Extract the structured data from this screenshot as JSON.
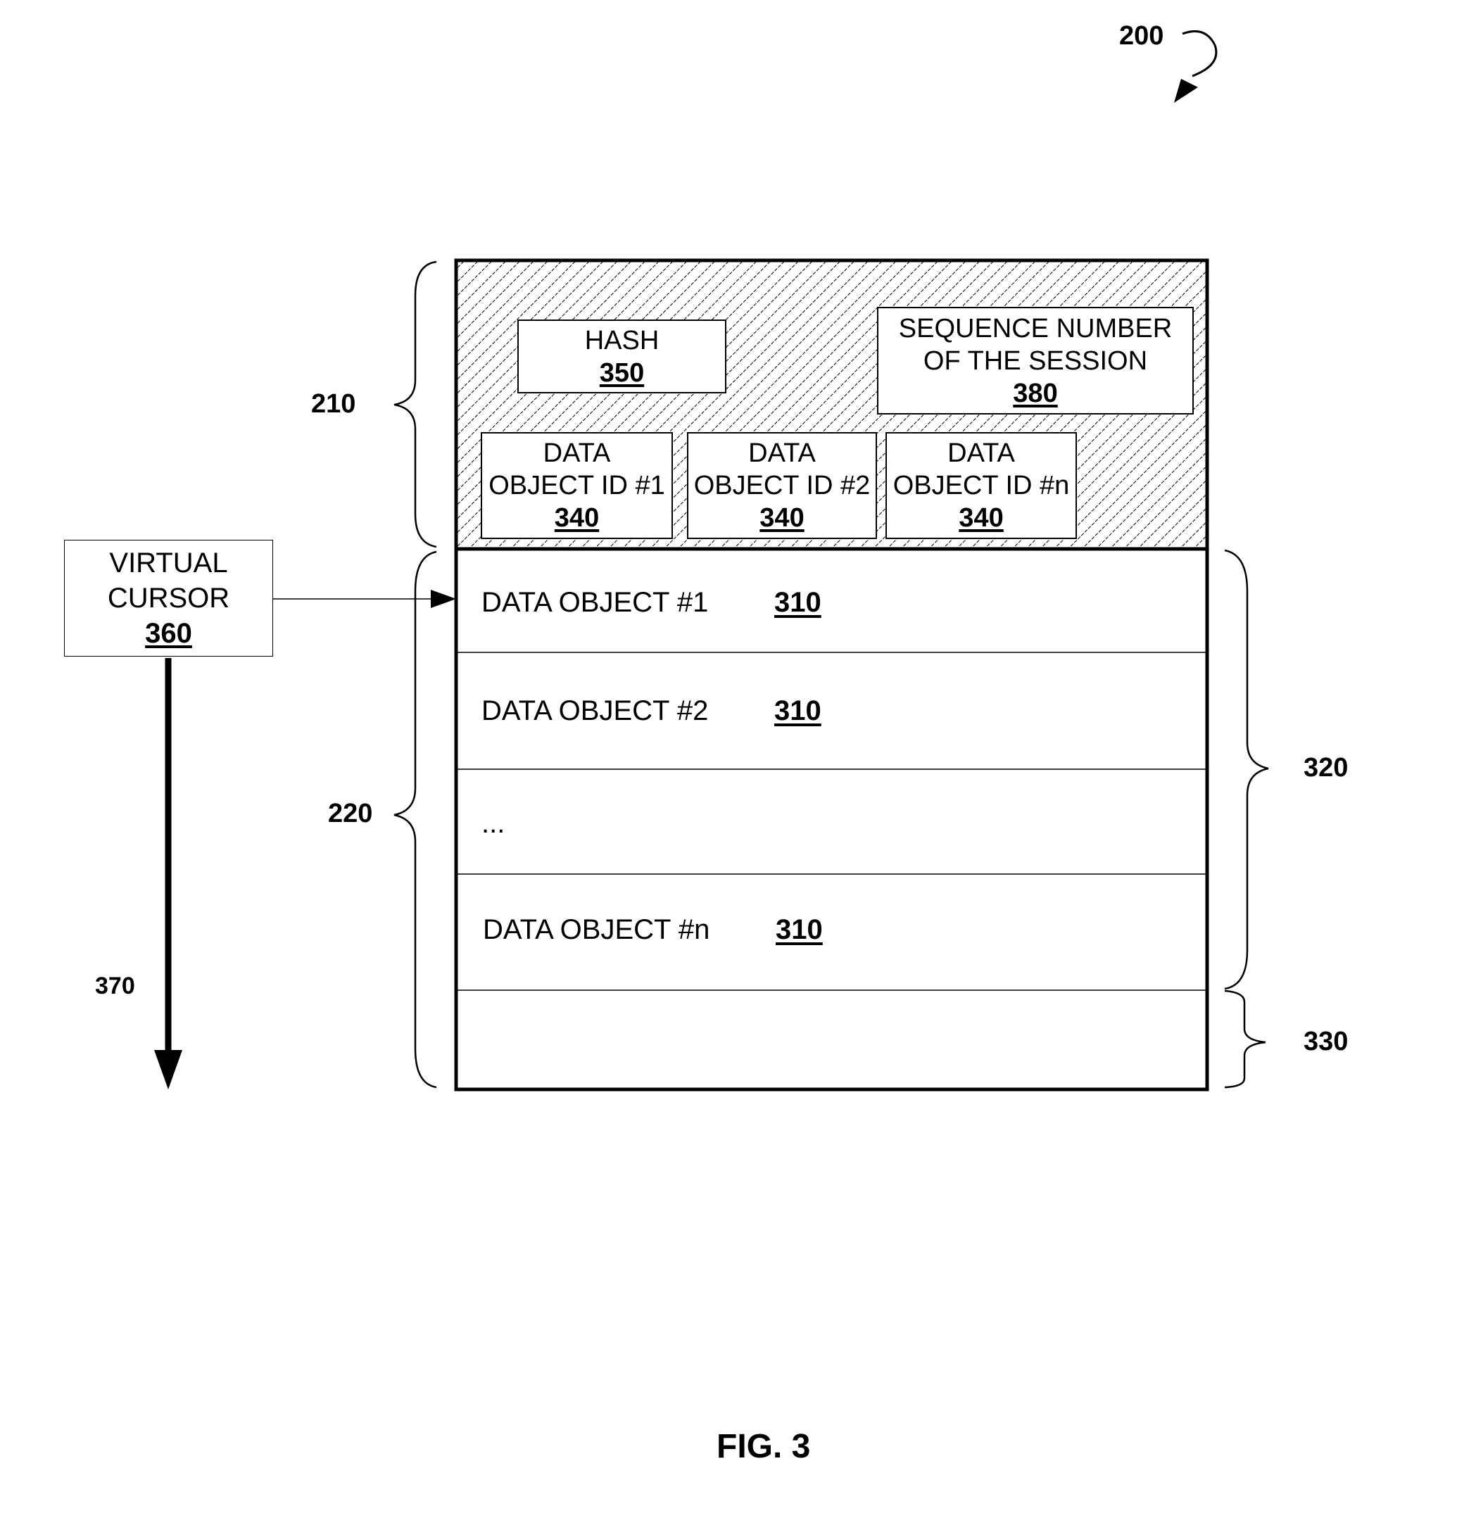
{
  "figure": {
    "title": "FIG. 3",
    "ref_main": "200"
  },
  "header": {
    "ref": "210",
    "hash": {
      "label": "HASH",
      "num": "350"
    },
    "sequence": {
      "line1": "SEQUENCE NUMBER",
      "line2": "OF THE SESSION",
      "num": "380"
    },
    "ids": [
      {
        "line1": "DATA",
        "line2": "OBJECT ID #1",
        "num": "340"
      },
      {
        "line1": "DATA",
        "line2": "OBJECT ID #2",
        "num": "340"
      },
      {
        "line1": "DATA",
        "line2": "OBJECT ID #n",
        "num": "340"
      }
    ]
  },
  "body": {
    "ref": "220",
    "rows": [
      {
        "label": "DATA OBJECT #1",
        "num": "310"
      },
      {
        "label": "DATA OBJECT #2",
        "num": "310"
      },
      {
        "label": "...",
        "num": ""
      },
      {
        "label": "DATA OBJECT #n",
        "num": "310"
      }
    ],
    "objects_ref": "320",
    "free_space_ref": "330"
  },
  "cursor": {
    "line1": "VIRTUAL",
    "line2": "CURSOR",
    "num": "360",
    "direction_ref": "370"
  }
}
